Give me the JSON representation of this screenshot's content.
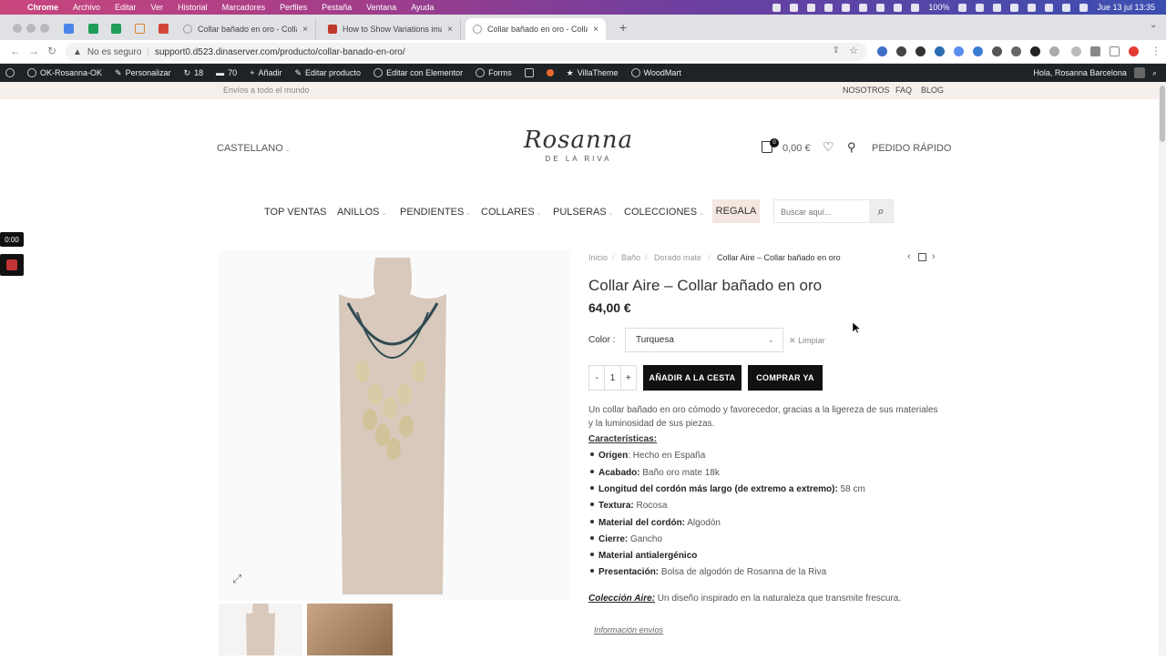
{
  "macos": {
    "apple": "",
    "app": "Chrome",
    "menus": [
      "Archivo",
      "Editar",
      "Ver",
      "Historial",
      "Marcadores",
      "Perfiles",
      "Pestaña",
      "Ventana",
      "Ayuda"
    ],
    "battery": "100%",
    "datetime": "Jue 13 jul  13:35"
  },
  "browser": {
    "tabs": [
      {
        "title": "Collar bañado en oro - Collar A...",
        "close": "×"
      },
      {
        "title": "How to Show Variations image...",
        "close": "×"
      },
      {
        "title": "Collar bañado en oro - Collar A...",
        "close": "×"
      }
    ],
    "new_tab": "+",
    "security": "No es seguro",
    "url": "support0.d523.dinaserver.com/producto/collar-banado-en-oro/"
  },
  "wpadmin": {
    "site": "OK-Rosanna-OK",
    "customize": "Personalizar",
    "updates": "18",
    "comments": "70",
    "add": "Añadir",
    "edit_product": "Editar producto",
    "elementor": "Editar con Elementor",
    "forms": "Forms",
    "villatheme": "VillaTheme",
    "woodmart": "WoodMart",
    "greeting": "Hola, Rosanna Barcelona"
  },
  "topstrip": {
    "shipping": "Envíos a todo el mundo",
    "links": [
      "NOSOTROS",
      "FAQ",
      "BLOG"
    ]
  },
  "header": {
    "language": "CASTELLANO",
    "logo_script": "Rosanna",
    "logo_sub": "DE LA RIVA",
    "cart_count": "0",
    "cart_total": "0,00 €",
    "quick_order": "PEDIDO RÁPIDO"
  },
  "nav": {
    "items": [
      "TOP VENTAS",
      "ANILLOS",
      "PENDIENTES",
      "COLLARES",
      "PULSERAS",
      "COLECCIONES"
    ],
    "regala": "REGALA",
    "search_placeholder": "Buscar aquí..."
  },
  "video_widget": {
    "time": "0:00"
  },
  "product": {
    "breadcrumb": [
      "Inicio",
      "Baño",
      "Dorado mate",
      "Collar Aire – Collar bañado en oro"
    ],
    "title": "Collar Aire – Collar bañado en oro",
    "price": "64,00 €",
    "color_label": "Color",
    "color_value": "Turquesa",
    "clear": "Limpiar",
    "qty_minus": "-",
    "qty": "1",
    "qty_plus": "+",
    "add_to_cart": "AÑADIR A LA CESTA",
    "buy_now": "COMPRAR YA",
    "description": "Un collar bañado en oro cómodo y favorecedor, gracias a la ligereza de sus materiales y la luminosidad de sus piezas.",
    "features_title": "Características:",
    "features": [
      {
        "k": "Origen",
        "v": ": Hecho en España"
      },
      {
        "k": "Acabado:",
        "v": " Baño oro mate 18k"
      },
      {
        "k": "Longitud del cordón más largo (de extremo a extremo):",
        "v": " 58 cm"
      },
      {
        "k": "Textura:",
        "v": " Rocosa"
      },
      {
        "k": "Material del cordón:",
        "v": " Algodón"
      },
      {
        "k": "Cierre:",
        "v": " Gancho"
      },
      {
        "k": "Material antialergénico",
        "v": ""
      },
      {
        "k": "Presentación:",
        "v": " Bolsa de algodón de Rosanna de la Riva"
      }
    ],
    "collection_label": "Colección Aire:",
    "collection_text": " Un diseño inspirado en la naturaleza que transmite frescura.",
    "shipping_info": "Información envíos"
  }
}
